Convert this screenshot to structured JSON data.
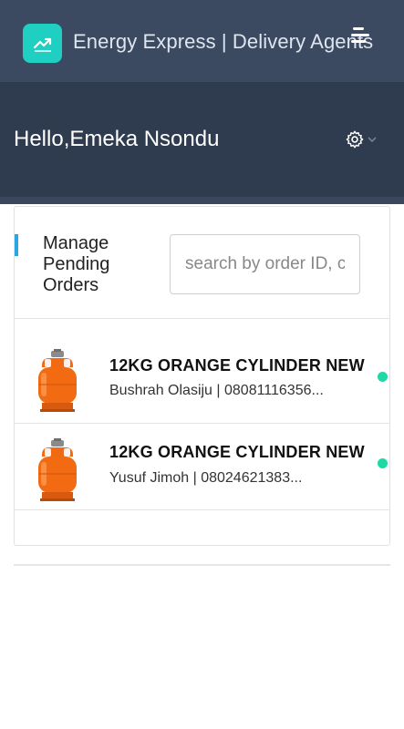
{
  "header": {
    "app_title": "Energy Express | Delivery Agents",
    "logo_icon": "trending-up-icon",
    "menu_icon": "menu-icon",
    "brand_color": "#1ecfc2"
  },
  "hero": {
    "greeting": "Hello,Emeka Nsondu",
    "settings_icon": "gear-icon"
  },
  "panel": {
    "title": "Manage Pending Orders",
    "search_placeholder": "search by order ID, customer"
  },
  "orders": [
    {
      "product": "12KG ORANGE CYLINDER NEW",
      "customer": "Bushrah Olasiju | 08081116356...",
      "status_color": "#1ed9a6"
    },
    {
      "product": "12KG ORANGE CYLINDER NEW",
      "customer": "Yusuf Jimoh | 08024621383...",
      "status_color": "#1ed9a6"
    }
  ]
}
